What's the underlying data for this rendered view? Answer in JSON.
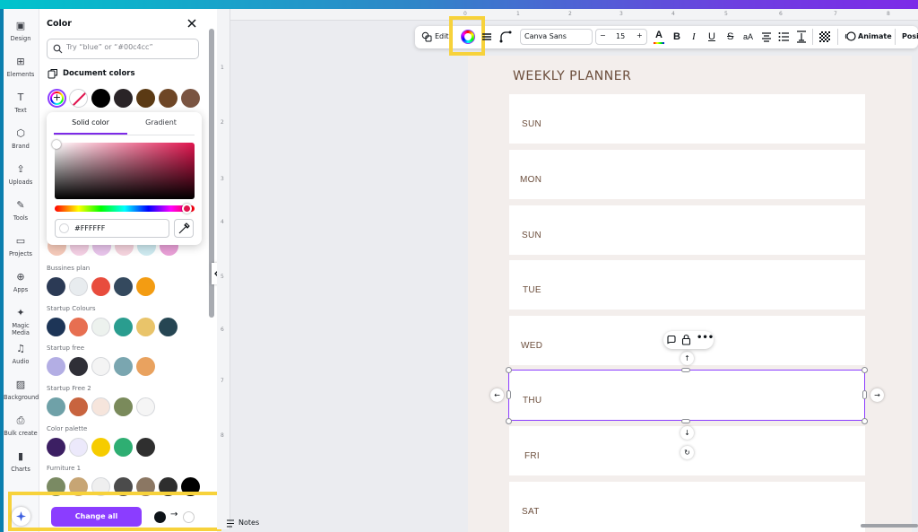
{
  "sidebar": {
    "items": [
      {
        "label": "Design",
        "icon": "design-icon"
      },
      {
        "label": "Elements",
        "icon": "elements-icon"
      },
      {
        "label": "Text",
        "icon": "text-icon"
      },
      {
        "label": "Brand",
        "icon": "brand-icon"
      },
      {
        "label": "Uploads",
        "icon": "uploads-icon"
      },
      {
        "label": "Tools",
        "icon": "tools-icon"
      },
      {
        "label": "Projects",
        "icon": "projects-icon"
      },
      {
        "label": "Apps",
        "icon": "apps-icon"
      },
      {
        "label": "Magic Media",
        "icon": "magic-media-icon"
      },
      {
        "label": "Audio",
        "icon": "audio-icon"
      },
      {
        "label": "Background",
        "icon": "background-icon"
      },
      {
        "label": "Bulk create",
        "icon": "bulk-create-icon"
      },
      {
        "label": "Charts",
        "icon": "charts-icon"
      }
    ]
  },
  "panel": {
    "title": "Color",
    "search_placeholder": "Try “blue” or “#00c4cc”",
    "document_colors_title": "Document colors",
    "document_colors": [
      "#000000",
      "#2a2427",
      "#5b3a14",
      "#6e4626",
      "#7a5441"
    ],
    "picker": {
      "tab_solid": "Solid color",
      "tab_gradient": "Gradient",
      "hex": "#FFFFFF"
    },
    "palettes": [
      {
        "name": "Bussines plan",
        "colors": [
          "#2b3a55",
          "#e8ecef",
          "#e84c3d",
          "#34495e",
          "#f39c12"
        ]
      },
      {
        "name": "Startup Colours",
        "colors": [
          "#1d3557",
          "#e76f51",
          "#edf2ee",
          "#2a9d8f",
          "#e9c46a",
          "#264653"
        ]
      },
      {
        "name": "Startup free",
        "colors": [
          "#b3aee4",
          "#2f2f37",
          "#f4f4f4",
          "#7aa6b0",
          "#e9a25f"
        ]
      },
      {
        "name": "Startup Free 2",
        "colors": [
          "#6fa1a8",
          "#c8643f",
          "#f6e5dc",
          "#7a8a5b",
          "#f5f5f5"
        ]
      },
      {
        "name": "Color palette",
        "colors": [
          "#3c1f63",
          "#ece9fb",
          "#f6cc00",
          "#2eae72",
          "#2f2f2f"
        ]
      },
      {
        "name": "Furniture 1",
        "colors": [
          "#7a8a63",
          "#c7a574",
          "#efefef",
          "#4b4b4b",
          "#8b7763",
          "#2e2e2e",
          "#000000"
        ]
      }
    ],
    "partial_row": [
      "#f4c9b9",
      "#f3cfe3",
      "#e7c4ea",
      "#f4d3dd",
      "#cde9ef",
      "#e89fd6"
    ],
    "change_all_label": "Change all",
    "change_from": "#000000",
    "change_to": "#FFFFFF"
  },
  "toolbar": {
    "edit_label": "Edit",
    "font": "Canva Sans",
    "font_size": "15",
    "minus": "−",
    "plus": "+",
    "animate_label": "Animate",
    "position_label": "Posit"
  },
  "rulers": {
    "top": [
      "0",
      "1",
      "2",
      "3",
      "4",
      "5",
      "6",
      "7",
      "8"
    ],
    "left": [
      "1",
      "2",
      "3",
      "4",
      "5",
      "6",
      "7",
      "8"
    ]
  },
  "canvas": {
    "title": "WEEKLY PLANNER",
    "days": [
      "SUN",
      "MON",
      "SUN",
      "TUE",
      "WED",
      "THU",
      "FRI",
      "SAT"
    ],
    "selected_index": 5
  },
  "footer": {
    "notes_label": "Notes"
  },
  "colors": {
    "accent": "#8b3dff",
    "highlight": "#f7d23b",
    "text_brown": "#6b4d3b"
  }
}
